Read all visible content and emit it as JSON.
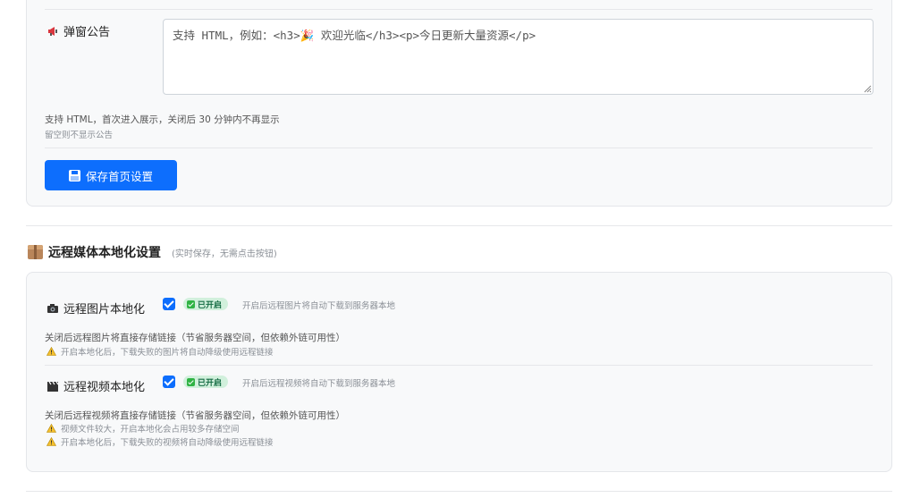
{
  "announcement": {
    "label": "弹窗公告",
    "label_icon": "megaphone-icon",
    "textarea_value": "支持 HTML，例如：<h3>🎉 欢迎光临</h3><p>今日更新大量资源</p>",
    "help_primary": "支持 HTML，首次进入展示，关闭后 30 分钟内不再显示",
    "help_secondary": "留空则不显示公告"
  },
  "save_button": {
    "label": "保存首页设置",
    "icon": "floppy-disk-icon"
  },
  "media_section": {
    "title": "远程媒体本地化设置",
    "subtitle": "(实时保存，无需点击按钮)",
    "title_icon": "package-icon",
    "items": [
      {
        "label": "远程图片本地化",
        "icon": "camera-icon",
        "checked": true,
        "badge": "已开启",
        "hint": "开启后远程图片将自动下载到服务器本地",
        "description": "关闭后远程图片将直接存储链接（节省服务器空间，但依赖外链可用性）",
        "warnings": [
          "开启本地化后，下载失败的图片将自动降级使用远程链接"
        ]
      },
      {
        "label": "远程视频本地化",
        "icon": "clapperboard-icon",
        "checked": true,
        "badge": "已开启",
        "hint": "开启后远程视频将自动下载到服务器本地",
        "description": "关闭后远程视频将直接存储链接（节省服务器空间，但依赖外链可用性）",
        "warnings": [
          "视频文件较大，开启本地化会占用较多存储空间",
          "开启本地化后，下载失败的视频将自动降级使用远程链接"
        ]
      }
    ]
  },
  "colors": {
    "primary": "#0d6efd",
    "badge_bg": "#d1f0dc",
    "badge_text": "#146c43",
    "card_bg": "#f8f9fa"
  }
}
